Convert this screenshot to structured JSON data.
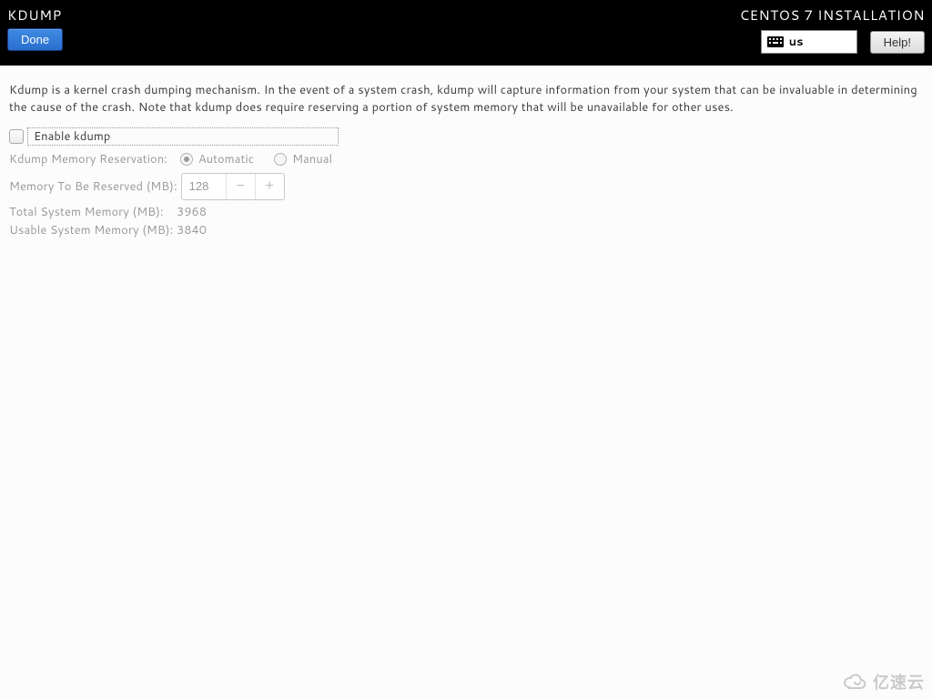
{
  "header": {
    "title": "KDUMP",
    "done_label": "Done",
    "install_title": "CENTOS 7 INSTALLATION",
    "keyboard_layout": "us",
    "help_label": "Help!"
  },
  "main": {
    "description": "Kdump is a kernel crash dumping mechanism. In the event of a system crash, kdump will capture information from your system that can be invaluable in determining the cause of the crash. Note that kdump does require reserving a portion of system memory that will be unavailable for other uses.",
    "enable_label": "Enable kdump",
    "enable_checked": false,
    "mem_reservation_label": "Kdump Memory Reservation:",
    "radio_automatic": "Automatic",
    "radio_manual": "Manual",
    "radio_selected": "automatic",
    "mem_to_reserve_label": "Memory To Be Reserved (MB):",
    "mem_to_reserve_value": "128",
    "total_mem_label": "Total System Memory (MB):",
    "total_mem_value": "3968",
    "usable_mem_label": "Usable System Memory (MB):",
    "usable_mem_value": "3840"
  },
  "watermark": {
    "text": "亿速云"
  }
}
